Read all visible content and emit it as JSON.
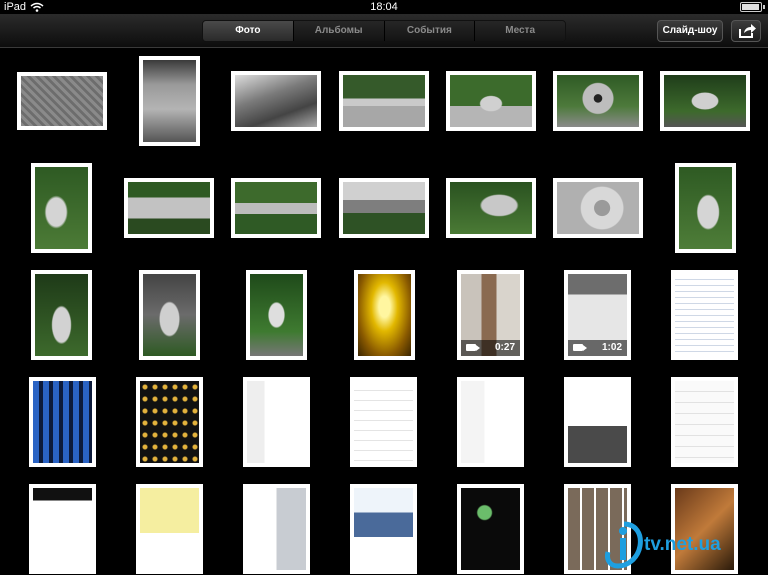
{
  "status_bar": {
    "device": "iPad",
    "time": "18:04",
    "wifi_icon": "wifi-icon",
    "battery_icon": "battery-icon"
  },
  "toolbar": {
    "tabs": [
      {
        "label": "Фото",
        "active": true
      },
      {
        "label": "Альбомы",
        "active": false
      },
      {
        "label": "События",
        "active": false
      },
      {
        "label": "Места",
        "active": false
      }
    ],
    "slideshow_label": "Слайд-шоу",
    "share_icon": "share-icon"
  },
  "videos": [
    {
      "duration": "0:27"
    },
    {
      "duration": "1:02"
    }
  ],
  "watermark": {
    "text": "tv.net.ua"
  }
}
